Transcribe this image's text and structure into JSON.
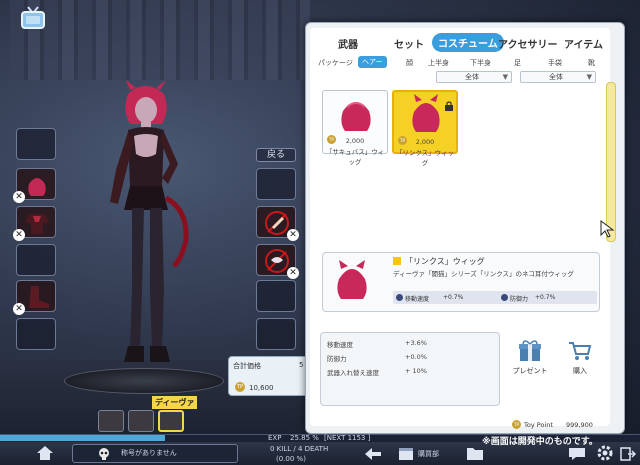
{
  "top_tabs": [
    {
      "label": "武器",
      "active": false
    },
    {
      "label": "セット",
      "active": false
    },
    {
      "label": "コスチューム",
      "active": true
    },
    {
      "label": "アクセサリー",
      "active": false
    },
    {
      "label": "アイテム",
      "active": false
    }
  ],
  "sub_tabs": [
    {
      "label": "パッケージ",
      "active": false
    },
    {
      "label": "ヘアー",
      "active": true
    },
    {
      "label": "顔",
      "active": false
    },
    {
      "label": "上半身",
      "active": false
    },
    {
      "label": "下半身",
      "active": false
    },
    {
      "label": "足",
      "active": false
    },
    {
      "label": "手袋",
      "active": false
    },
    {
      "label": "靴",
      "active": false
    }
  ],
  "filters": [
    {
      "value": "全体"
    },
    {
      "value": "全体"
    }
  ],
  "items": [
    {
      "price": "2,000",
      "name": "「サキュバス」ウィッグ",
      "selected": false,
      "currency": "TP"
    },
    {
      "price": "2,000",
      "name": "「リンクス」ウィッグ",
      "selected": true,
      "currency": "TP"
    }
  ],
  "detail": {
    "title": "「リンクス」ウィッグ",
    "description": "ディーヴァ「闇猫」シリーズ「リンクス」のネコ耳付ウィッグ",
    "bonus1_label": "移動速度",
    "bonus1_value": "+0.7%",
    "bonus2_label": "防御力",
    "bonus2_value": "+0.7%"
  },
  "stats": [
    {
      "label": "移動速度",
      "value": "+3.6%"
    },
    {
      "label": "防御力",
      "value": "+0.0%"
    },
    {
      "label": "武器入れ替え速度",
      "value": "+ 10%"
    }
  ],
  "actions": {
    "gift": "プレゼント",
    "buy": "購入"
  },
  "price_box": {
    "label": "合計価格",
    "count": "5",
    "total": "10,600",
    "currency": "TP"
  },
  "toy_point": {
    "currency": "TP",
    "label": "Toy Point",
    "value": "999,900"
  },
  "character": {
    "name": "ディーヴァ",
    "back_label": "戻る"
  },
  "bottom": {
    "exp_label": "EXP",
    "exp_value": "25.85 %",
    "exp_next": "[NEXT 1153 ]",
    "exp_progress": 0.2585,
    "title_text": "称号がありません",
    "kill_death": "0 KILL / 4 DEATH",
    "kd_ratio": "(0.00 %)",
    "club": "購買部",
    "notice": "※画面は開発中のものです。"
  },
  "colors": {
    "accent": "#3a9dde",
    "selected_item": "#f5d126",
    "exp_bar": "#4ea8d8"
  }
}
